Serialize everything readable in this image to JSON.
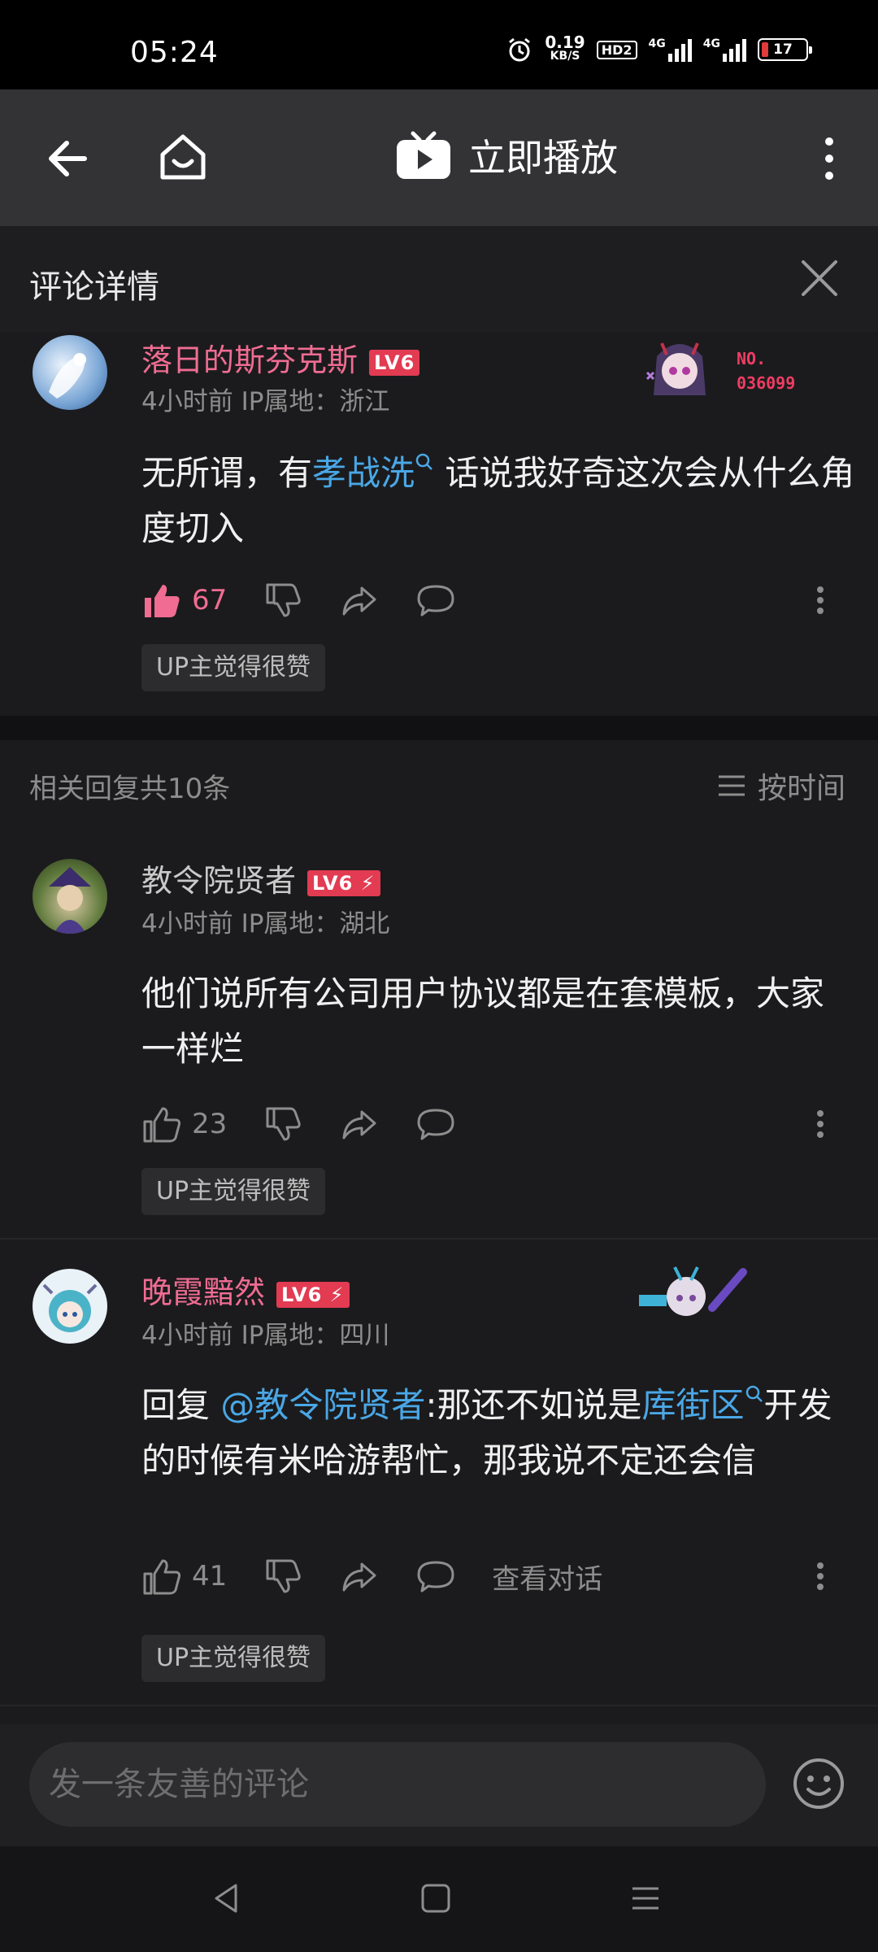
{
  "status": {
    "time": "05:24",
    "speed_value": "0.19",
    "speed_unit": "KB/S",
    "hd": "HD2",
    "net1": "4G",
    "net2": "4G",
    "battery": "17"
  },
  "nav": {
    "play_label": "立即播放"
  },
  "panel": {
    "title": "评论详情"
  },
  "main_comment": {
    "user": "落日的斯芬克斯",
    "level": "LV6",
    "meta": "4小时前  IP属地：浙江",
    "text_a": "无所谓，有",
    "link": "孝战洗",
    "text_b": " 话说我好奇这次会从什么角度切入",
    "likes": "67",
    "badge": "UP主觉得很赞",
    "fan_no_label": "NO.",
    "fan_no": "036099"
  },
  "replies_header": {
    "count": "相关回复共10条",
    "sort": "按时间"
  },
  "replies": [
    {
      "user": "教令院贤者",
      "level": "LV6",
      "meta": "4小时前  IP属地：湖北",
      "text": "他们说所有公司用户协议都是在套模板，大家一样烂",
      "likes": "23",
      "badge": "UP主觉得很赞"
    },
    {
      "user": "晚霞黯然",
      "level": "LV6",
      "meta": "4小时前  IP属地：四川",
      "text_a": "回复 ",
      "mention": "@教令院贤者",
      "text_b": ":那还不如说是",
      "link": "库街区",
      "text_c": "开发的时候有米哈游帮忙，那我说不定还会信",
      "likes": "41",
      "view_talk": "查看对话",
      "badge": "UP主觉得很赞"
    }
  ],
  "input": {
    "placeholder": "发一条友善的评论"
  },
  "colors": {
    "accent_pink": "#f06c92",
    "link_blue": "#4aa7e6",
    "level_red": "#e23b52"
  }
}
